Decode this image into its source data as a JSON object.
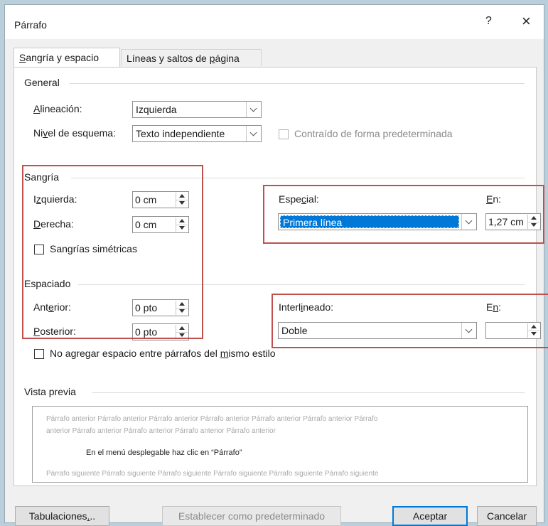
{
  "window": {
    "title": "Párrafo",
    "help": "?",
    "close": "×"
  },
  "tabs": [
    {
      "label_pre": "",
      "label_u": "S",
      "label_post": "angría y espacio"
    },
    {
      "label_pre": "Líneas y saltos de ",
      "label_u": "p",
      "label_post": "ágina"
    }
  ],
  "general": {
    "title": "General",
    "alignment": {
      "label_pre": "",
      "label_u": "A",
      "label_post": "lineación:",
      "value": "Izquierda"
    },
    "outline": {
      "label_pre": "Ni",
      "label_u": "v",
      "label_post": "el de esquema:",
      "value": "Texto independiente"
    },
    "collapsed_label": "Contraído de forma predeterminada"
  },
  "indent": {
    "title": "Sangría",
    "left": {
      "label_pre": "I",
      "label_u": "z",
      "label_post": "quierda:",
      "value": "0 cm"
    },
    "right": {
      "label_pre": "",
      "label_u": "D",
      "label_post": "erecha:",
      "value": "0 cm"
    },
    "mirror": {
      "label_pre": "San",
      "label_u": "g",
      "label_post": "rías simétricas"
    },
    "special": {
      "label_pre": "Espe",
      "label_u": "c",
      "label_post": "ial:",
      "value": "Primera línea"
    },
    "by": {
      "label_pre": "",
      "label_u": "E",
      "label_post": "n:",
      "value": "1,27 cm"
    }
  },
  "spacing": {
    "title": "Espaciado",
    "before": {
      "label_pre": "Ant",
      "label_u": "e",
      "label_post": "rior:",
      "value": "0 pto"
    },
    "after": {
      "label_pre": "",
      "label_u": "P",
      "label_post": "osterior:",
      "value": "0 pto"
    },
    "line": {
      "label_pre": "Interl",
      "label_u": "i",
      "label_post": "neado:",
      "value": "Doble"
    },
    "at": {
      "label_pre": "E",
      "label_u": "n",
      "label_post": ":",
      "value": ""
    },
    "no_space": {
      "label_pre": "No agregar espacio entre párrafos del ",
      "label_u": "m",
      "label_post": "ismo estilo"
    }
  },
  "preview": {
    "title": "Vista previa",
    "prev_line1": "Párrafo anterior Párrafo anterior Párrafo anterior Párrafo anterior Párrafo anterior Párrafo anterior Párrafo",
    "prev_line2": "anterior Párrafo anterior Párrafo anterior Párrafo anterior Párrafo anterior",
    "main": "En el menú desplegable haz clic en “Párrafo”",
    "next_line": "Párrafo siguiente Párrafo siguiente Párrafo siguiente Párrafo siguiente Párrafo siguiente Párrafo siguiente"
  },
  "buttons": {
    "tabs": {
      "label_pre": "Tabulaciones",
      "label_u": ".",
      "label_post": ".."
    },
    "default": "Establecer como predeterminado",
    "ok": "Aceptar",
    "cancel": "Cancelar"
  },
  "colors": {
    "highlight": "#c0504d",
    "selection": "#0078d7",
    "background": "#b9cfdc"
  }
}
